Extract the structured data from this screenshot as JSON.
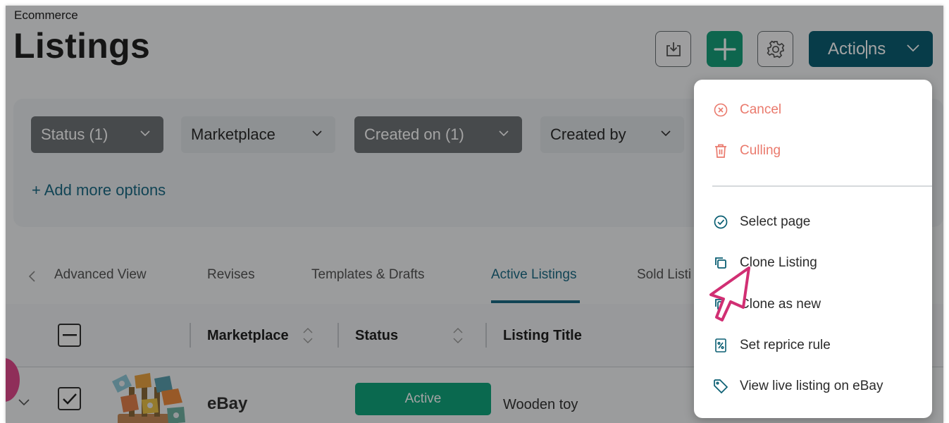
{
  "header": {
    "section": "Ecommerce",
    "title": "Listings",
    "actions_label_start": "Actio",
    "actions_label_end": "ns"
  },
  "filters": {
    "chips": [
      "Status (1)",
      "Marketplace",
      "Created on (1)",
      "Created by"
    ],
    "add_more": "+ Add more options"
  },
  "tabs": [
    "Advanced View",
    "Revises",
    "Templates & Drafts",
    "Active Listings",
    "Sold Listi"
  ],
  "table": {
    "columns": [
      "Marketplace",
      "Status",
      "Listing Title"
    ],
    "rows": [
      {
        "marketplace": "eBay",
        "status": "Active",
        "title": "Wooden toy"
      }
    ]
  },
  "actions_menu": {
    "danger_items": [
      "Cancel",
      "Culling"
    ],
    "items": [
      "Select page",
      "Clone Listing",
      "Clone as new",
      "Set reprice rule",
      "View live listing on eBay"
    ]
  },
  "colors": {
    "brand": "#0b5f73",
    "accent_green": "#16a07b",
    "danger": "#ea7a6d",
    "cursor_pink": "#d12f73"
  }
}
